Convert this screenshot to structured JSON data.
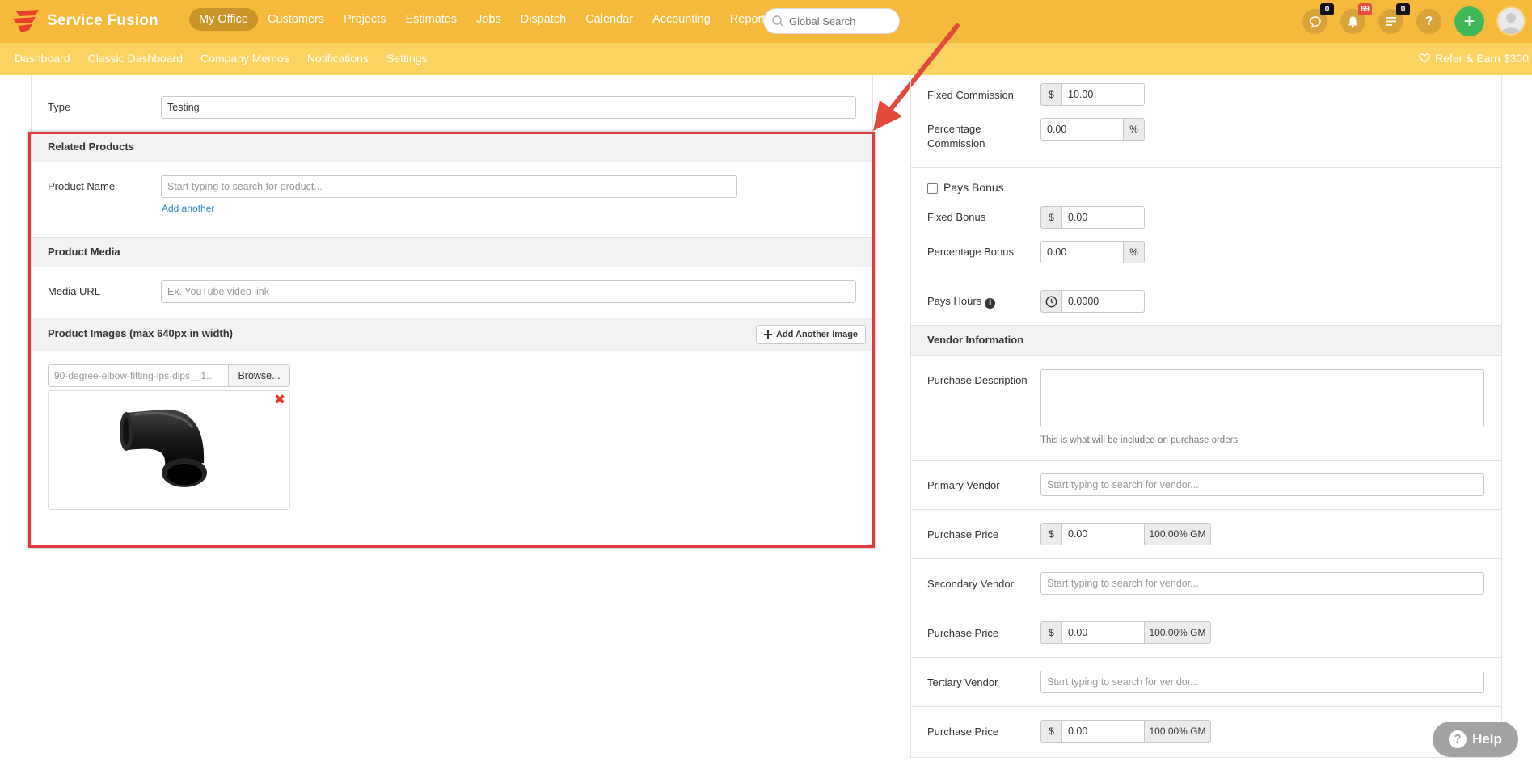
{
  "app": {
    "brand": "Service Fusion",
    "nav": [
      "My Office",
      "Customers",
      "Projects",
      "Estimates",
      "Jobs",
      "Dispatch",
      "Calendar",
      "Accounting",
      "Reports"
    ],
    "active_nav": "My Office",
    "search_placeholder": "Global Search",
    "badges": {
      "messages": "0",
      "notifications": "69",
      "tasks": "0"
    },
    "help_icon_label": "?",
    "plus_label": "+"
  },
  "subnav": {
    "items": [
      "Dashboard",
      "Classic Dashboard",
      "Company Memos",
      "Notifications",
      "Settings"
    ],
    "refer": "Refer & Earn $300"
  },
  "left": {
    "type_label": "Type",
    "type_value": "Testing",
    "related_products": {
      "heading": "Related Products",
      "product_name_label": "Product Name",
      "product_placeholder": "Start typing to search for product...",
      "add_another": "Add another"
    },
    "product_media": {
      "heading": "Product Media",
      "media_url_label": "Media URL",
      "media_url_placeholder": "Ex. YouTube video link"
    },
    "product_images": {
      "heading": "Product Images (max 640px in width)",
      "add_image_button": "Add Another Image",
      "file_name": "90-degree-elbow-fitting-ips-dips__1...",
      "browse": "Browse..."
    }
  },
  "right": {
    "fixed_commission_label": "Fixed Commission",
    "currency": "$",
    "fixed_commission_value": "10.00",
    "percentage_commission_label": "Percentage Commission",
    "percentage_commission_value": "0.00",
    "percent": "%",
    "pays_bonus_label": "Pays Bonus",
    "fixed_bonus_label": "Fixed Bonus",
    "fixed_bonus_value": "0.00",
    "percentage_bonus_label": "Percentage Bonus",
    "percentage_bonus_value": "0.00",
    "pays_hours_label": "Pays Hours",
    "pays_hours_value": "0.0000",
    "vendor_heading": "Vendor Information",
    "purchase_description_label": "Purchase Description",
    "purchase_description_help": "This is what will be included on purchase orders",
    "primary_vendor_label": "Primary Vendor",
    "secondary_vendor_label": "Secondary Vendor",
    "tertiary_vendor_label": "Tertiary Vendor",
    "vendor_placeholder": "Start typing to search for vendor...",
    "purchase_price_label": "Purchase Price",
    "purchase_price_value": "0.00",
    "gm_value": "100.00% GM"
  },
  "help_button": "Help"
}
